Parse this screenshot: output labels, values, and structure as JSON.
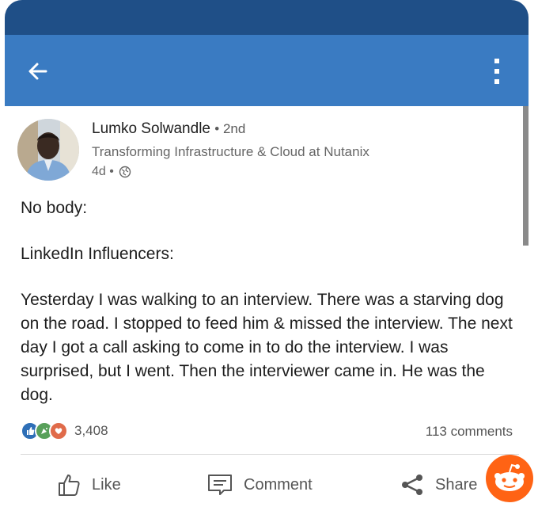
{
  "post": {
    "author": {
      "name": "Lumko Solwandle",
      "degree": "• 2nd",
      "headline": "Transforming Infrastructure & Cloud at Nutanix",
      "time": "4d •"
    },
    "body": {
      "line1": "No body:",
      "line2": "LinkedIn Influencers:",
      "line3": "Yesterday I was walking to an interview. There was a starving dog on the road. I stopped to feed him & missed the interview. The next day I got a call asking to come in to do the interview. I was surprised, but I went. Then the interviewer came in. He was the dog."
    },
    "reactions": {
      "count": "3,408",
      "icons": [
        "like-icon",
        "celebrate-icon",
        "love-icon"
      ]
    },
    "comments_count": "113 comments",
    "actions": {
      "like": "Like",
      "comment": "Comment",
      "share": "Share"
    }
  },
  "colors": {
    "appbar": "#3a7bc2",
    "device_top": "#1f4f87",
    "reddit": "#ff6314"
  }
}
